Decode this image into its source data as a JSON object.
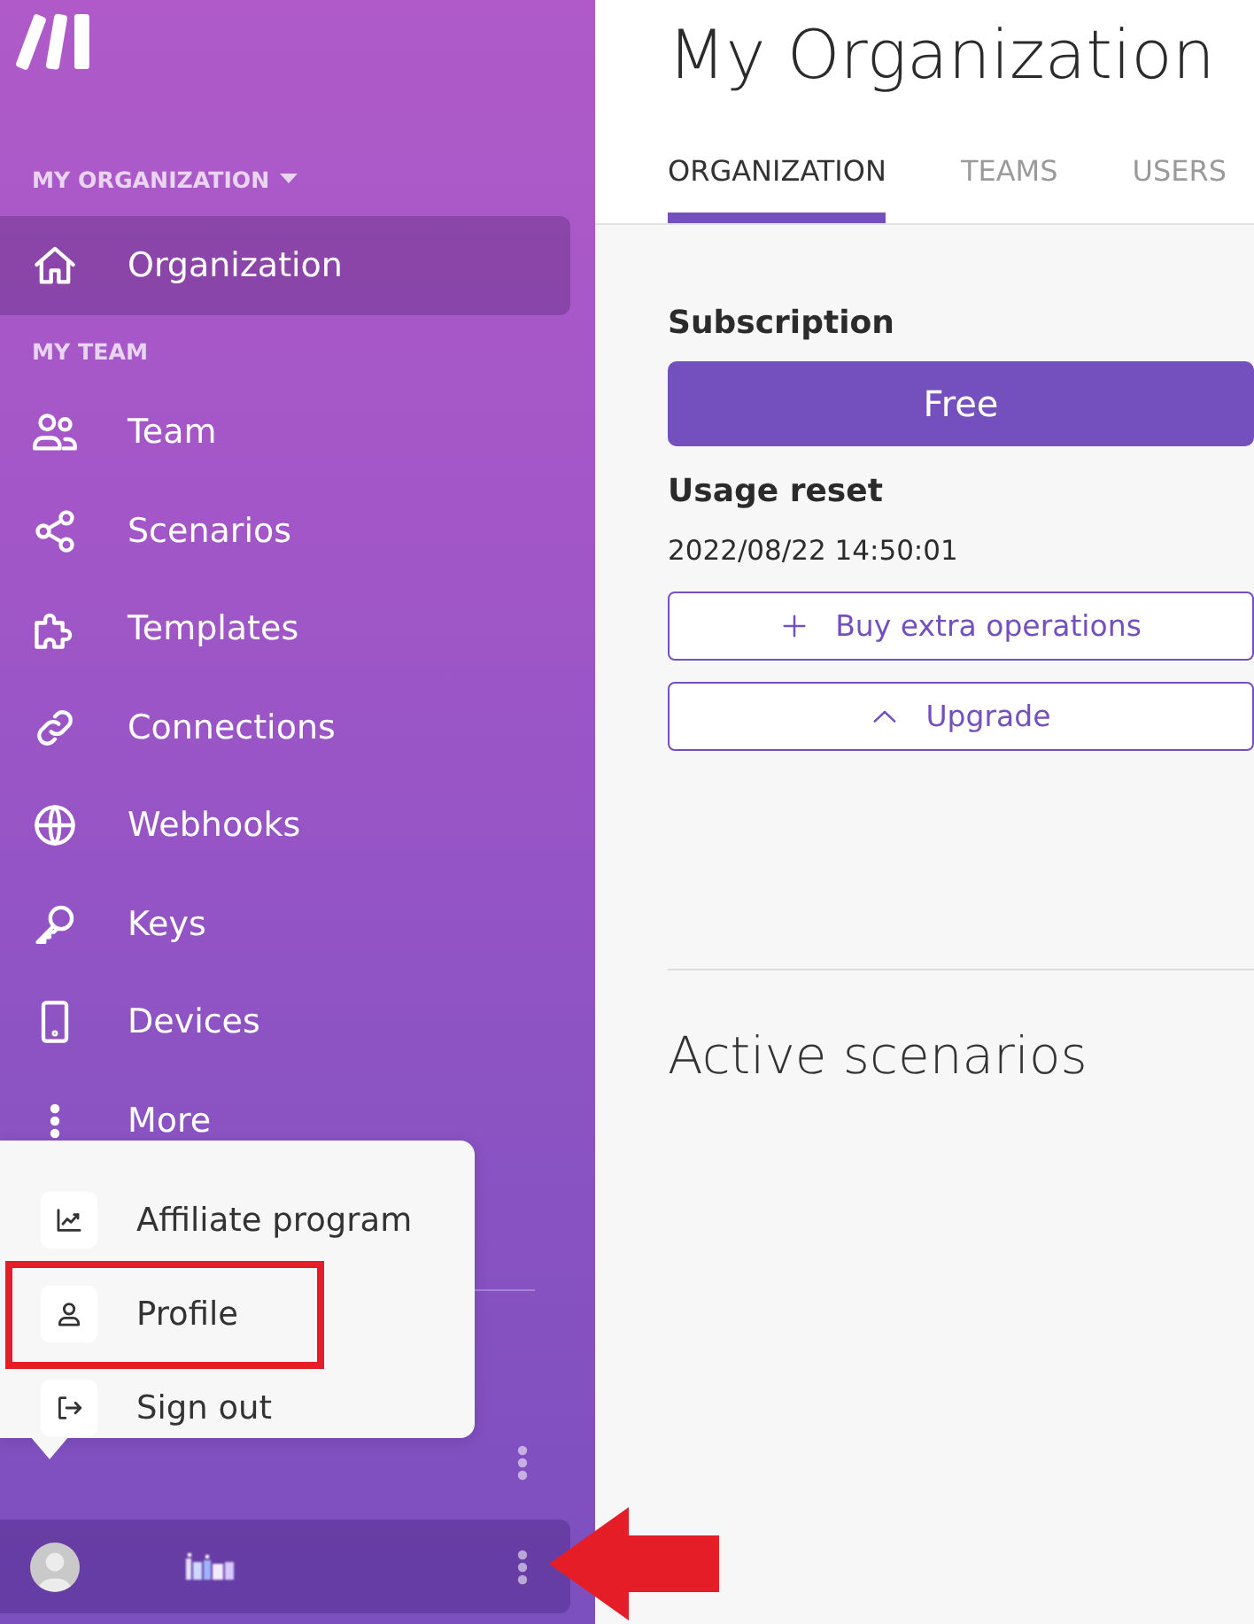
{
  "sidebar": {
    "sections": [
      {
        "heading": "MY ORGANIZATION",
        "dropdown": true,
        "items": [
          {
            "label": "Organization",
            "selected": true
          }
        ]
      },
      {
        "heading": "MY TEAM",
        "dropdown": false,
        "items": [
          {
            "label": "Team",
            "selected": false
          },
          {
            "label": "Scenarios",
            "selected": false
          },
          {
            "label": "Templates",
            "selected": false
          },
          {
            "label": "Connections",
            "selected": false
          },
          {
            "label": "Webhooks",
            "selected": false
          },
          {
            "label": "Keys",
            "selected": false
          },
          {
            "label": "Devices",
            "selected": false
          },
          {
            "label": "More",
            "selected": false
          }
        ]
      }
    ],
    "account_menu": {
      "open": true,
      "items": [
        {
          "label": "Affiliate program",
          "highlighted": false
        },
        {
          "label": "Profile",
          "highlighted": true
        },
        {
          "label": "Sign out",
          "highlighted": false
        }
      ]
    },
    "user_bar": {
      "arrow_annotation": true
    }
  },
  "main": {
    "title": "My Organization",
    "tabs": [
      {
        "label": "ORGANIZATION",
        "selected": true
      },
      {
        "label": "TEAMS",
        "selected": false
      },
      {
        "label": "USERS",
        "selected": false
      }
    ],
    "subscription": {
      "heading": "Subscription",
      "plan": "Free"
    },
    "usage_reset": {
      "heading": "Usage reset",
      "value": "2022/08/22 14:50:01"
    },
    "actions": [
      {
        "label": "Buy extra operations"
      },
      {
        "label": "Upgrade"
      }
    ],
    "active_scenarios": {
      "heading": "Active scenarios"
    }
  }
}
